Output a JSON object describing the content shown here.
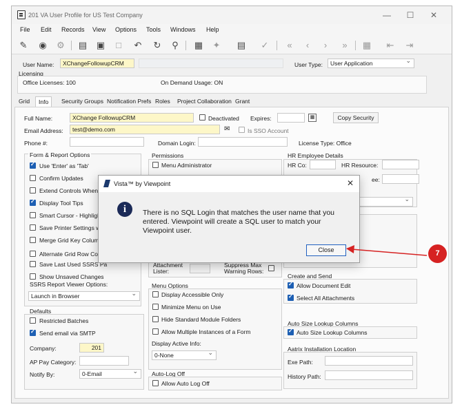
{
  "window": {
    "title": "201 VA User Profile for US Test Company",
    "minimize_glyph": "—",
    "maximize_glyph": "☐",
    "close_glyph": "✕"
  },
  "menu": [
    "File",
    "Edit",
    "Records",
    "View",
    "Options",
    "Tools",
    "Windows",
    "Help"
  ],
  "top": {
    "user_name_label": "User Name:",
    "user_name_value": "XChangeFollowupCRM",
    "user_type_label": "User Type:",
    "user_type_value": "User Application",
    "licensing_label": "Licensing",
    "office_licenses": "Office Licenses: 100",
    "on_demand_usage": "On Demand Usage: ON"
  },
  "tabs": [
    "Grid",
    "Info",
    "Security Groups",
    "Notification Prefs",
    "Roles",
    "Project Collaboration",
    "Grant"
  ],
  "active_tab": "Info",
  "info": {
    "full_name_label": "Full Name:",
    "full_name_value": "XChange FollowupCRM",
    "deactivated_label": "Deactivated",
    "expires_label": "Expires:",
    "copy_security_label": "Copy Security",
    "email_label": "Email Address:",
    "email_value": "test@demo.com",
    "is_sso_label": "Is SSO Account",
    "phone_label": "Phone #:",
    "domain_login_label": "Domain Login:",
    "license_type": "License Type: Office"
  },
  "form_report": {
    "title": "Form & Report Options",
    "items": [
      {
        "label": "Use 'Enter' as 'Tab'",
        "checked": true
      },
      {
        "label": "Confirm Updates",
        "checked": false
      },
      {
        "label": "Extend Controls When E",
        "checked": false
      },
      {
        "label": "Display Tool Tips",
        "checked": true
      },
      {
        "label": "Smart Cursor - Highlight",
        "checked": false
      },
      {
        "label": "Save Printer Settings w",
        "checked": false
      },
      {
        "label": "Merge Grid Key Columns",
        "checked": false
      },
      {
        "label": "Alternate Grid Row Colo",
        "checked": false
      },
      {
        "label": "Save Last Used SSRS Pa",
        "checked": false
      },
      {
        "label": "Show Unsaved Changes",
        "checked": false
      }
    ],
    "ssrs_label": "SSRS Report Viewer Options:",
    "ssrs_value": "Launch in Browser"
  },
  "defaults": {
    "title": "Defaults",
    "restricted_batches": "Restricted Batches",
    "send_email_smtp": "Send email via SMTP",
    "company_label": "Company:",
    "company_value": "201",
    "ap_pay_category_label": "AP Pay Category:",
    "notify_by_label": "Notify By:",
    "notify_by_value": "0-Email"
  },
  "permissions": {
    "title": "Permissions",
    "menu_administrator": "Menu Administrator",
    "attachment_lister": "Attachment\nLister:",
    "suppress_max_warning": "Suppress Max\nWarning Rows:"
  },
  "menu_options": {
    "title": "Menu Options",
    "items": [
      {
        "label": "Display Accessible Only",
        "checked": false
      },
      {
        "label": "Minimize Menu on Use",
        "checked": false
      },
      {
        "label": "Hide Standard Module Folders",
        "checked": false
      },
      {
        "label": "Allow Multiple Instances of a Form",
        "checked": false
      }
    ],
    "display_active_info_label": "Display Active Info:",
    "display_active_info_value": "0-None"
  },
  "auto_log_off": {
    "title": "Auto-Log Off",
    "allow_label": "Allow Auto Log Off"
  },
  "hr": {
    "title": "HR Employee Details",
    "hr_co_label": "HR Co:",
    "hr_resource_label": "HR Resource:",
    "ee_fragment": "ee:"
  },
  "create_send": {
    "title": "Create and Send",
    "allow_document_edit": "Allow Document Edit",
    "select_all_attachments": "Select All Attachments"
  },
  "auto_size": {
    "title": "Auto Size Lookup Columns",
    "label": "Auto Size Lookup Columns"
  },
  "aatrix": {
    "title": "Aatrix Installation Location",
    "exe_path_label": "Exe Path:",
    "history_path_label": "History Path:"
  },
  "dialog": {
    "title": "Vista™ by Viewpoint",
    "message": "There is no SQL Login that matches the user name that you entered. Viewpoint will create a SQL user to match your Viewpoint user.",
    "close_label": "Close",
    "close_glyph": "✕",
    "info_glyph": "i"
  },
  "annotation": {
    "step_number": "7",
    "color": "#d62222"
  },
  "colors": {
    "accent": "#1d5fb3",
    "yellow_field": "#fdf7c8"
  }
}
